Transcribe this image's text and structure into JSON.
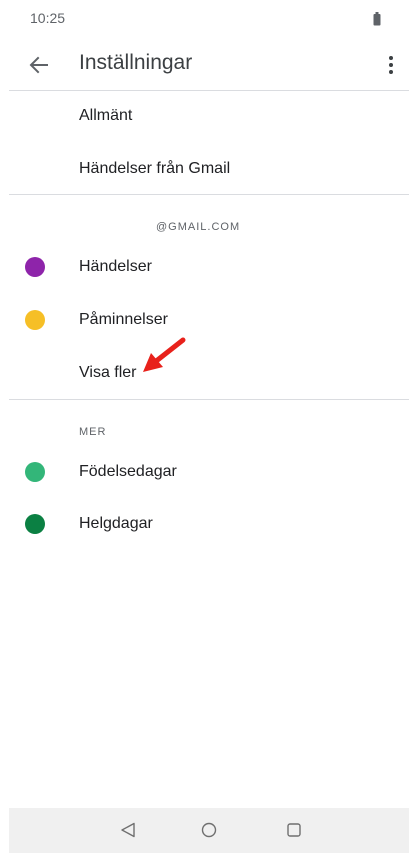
{
  "status_bar": {
    "time": "10:25"
  },
  "toolbar": {
    "title": "Inställningar",
    "back_icon": "arrow-back-icon",
    "overflow_icon": "more-vert-icon"
  },
  "general_items": [
    {
      "label": "Allmänt"
    },
    {
      "label": "Händelser från Gmail"
    }
  ],
  "account": {
    "header": "@GMAIL.COM",
    "calendars": [
      {
        "label": "Händelser",
        "color": "#8e24aa"
      },
      {
        "label": "Påminnelser",
        "color": "#f6bf26"
      }
    ],
    "show_more": "Visa fler"
  },
  "more": {
    "header": "MER",
    "calendars": [
      {
        "label": "Födelsedagar",
        "color": "#33b679"
      },
      {
        "label": "Helgdagar",
        "color": "#0b8043"
      }
    ]
  },
  "annotation": {
    "arrow_color": "#e8211b"
  },
  "nav_bar": {
    "back_icon": "triangle-back-icon",
    "home_icon": "circle-home-icon",
    "recents_icon": "square-recents-icon"
  }
}
